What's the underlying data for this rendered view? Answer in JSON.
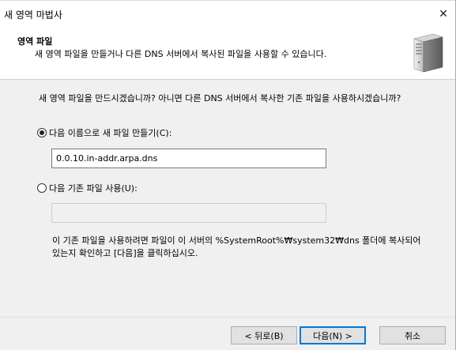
{
  "window": {
    "title": "새 영역 마법사",
    "close_glyph": "✕"
  },
  "header": {
    "title": "영역 파일",
    "subtitle": "새 영역 파일을 만들거나 다른 DNS 서버에서 복사된 파일을 사용할 수 있습니다.",
    "icon": "server-icon"
  },
  "main": {
    "question": "새 영역 파일을 만드시겠습니까? 아니면 다른 DNS 서버에서 복사한 기존 파일을 사용하시겠습니까?",
    "option_create": {
      "label": "다음 이름으로 새 파일 만들기(C):",
      "selected": true
    },
    "filename_value": "0.0.10.in-addr.arpa.dns",
    "option_existing": {
      "label": "다음 기존 파일 사용(U):",
      "selected": false
    },
    "existing_value": "",
    "note": "이 기존 파일을 사용하려면 파일이 이 서버의 %SystemRoot%₩system32₩dns 폴더에 복사되어 있는지 확인하고 [다음]을 클릭하십시오."
  },
  "footer": {
    "back_label": "< 뒤로(B)",
    "next_label": "다음(N) >",
    "cancel_label": "취소"
  }
}
